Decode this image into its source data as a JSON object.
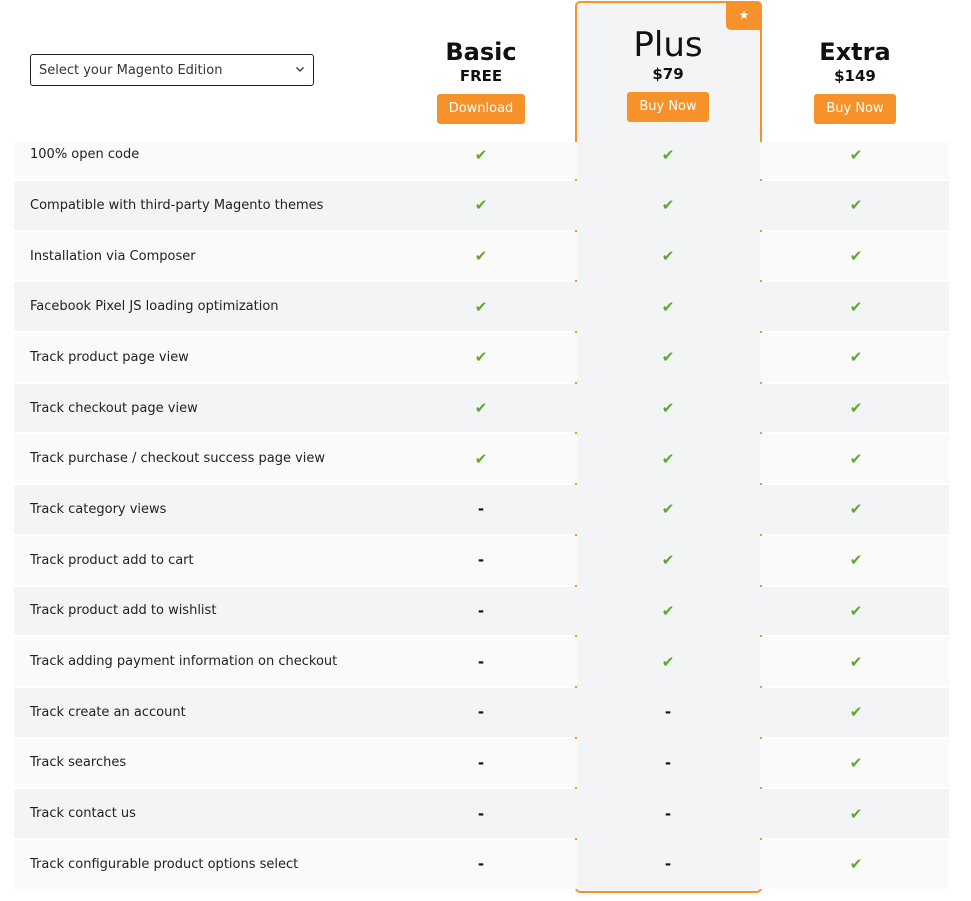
{
  "edition_select": {
    "value": "Select your Magento Edition"
  },
  "plans": [
    {
      "name": "Basic",
      "price": "FREE",
      "button": "Download",
      "featured": false
    },
    {
      "name": "Plus",
      "price": "$79",
      "button": "Buy Now",
      "featured": true,
      "badge_icon": "star-icon"
    },
    {
      "name": "Extra",
      "price": "$149",
      "button": "Buy Now",
      "featured": false
    }
  ],
  "symbols": {
    "check": "✔",
    "dash": "-"
  },
  "colors": {
    "accent": "#f7922a",
    "check": "#5ea82a",
    "row_light": "#fafafa",
    "row_dark": "#f3f4f6"
  },
  "features": [
    {
      "label": "100% open code",
      "values": [
        true,
        true,
        true
      ]
    },
    {
      "label": "Compatible with third-party Magento themes",
      "values": [
        true,
        true,
        true
      ]
    },
    {
      "label": "Installation via Composer",
      "values": [
        true,
        true,
        true
      ]
    },
    {
      "label": "Facebook Pixel JS loading optimization",
      "values": [
        true,
        true,
        true
      ]
    },
    {
      "label": "Track product page view",
      "values": [
        true,
        true,
        true
      ]
    },
    {
      "label": "Track checkout page view",
      "values": [
        true,
        true,
        true
      ]
    },
    {
      "label": "Track purchase / checkout success page view",
      "values": [
        true,
        true,
        true
      ]
    },
    {
      "label": "Track category views",
      "values": [
        false,
        true,
        true
      ]
    },
    {
      "label": "Track product add to cart",
      "values": [
        false,
        true,
        true
      ]
    },
    {
      "label": "Track product add to wishlist",
      "values": [
        false,
        true,
        true
      ]
    },
    {
      "label": "Track adding payment information on checkout",
      "values": [
        false,
        true,
        true
      ]
    },
    {
      "label": "Track create an account",
      "values": [
        false,
        false,
        true
      ]
    },
    {
      "label": "Track searches",
      "values": [
        false,
        false,
        true
      ]
    },
    {
      "label": "Track contact us",
      "values": [
        false,
        false,
        true
      ]
    },
    {
      "label": "Track configurable product options select",
      "values": [
        false,
        false,
        true
      ]
    }
  ]
}
